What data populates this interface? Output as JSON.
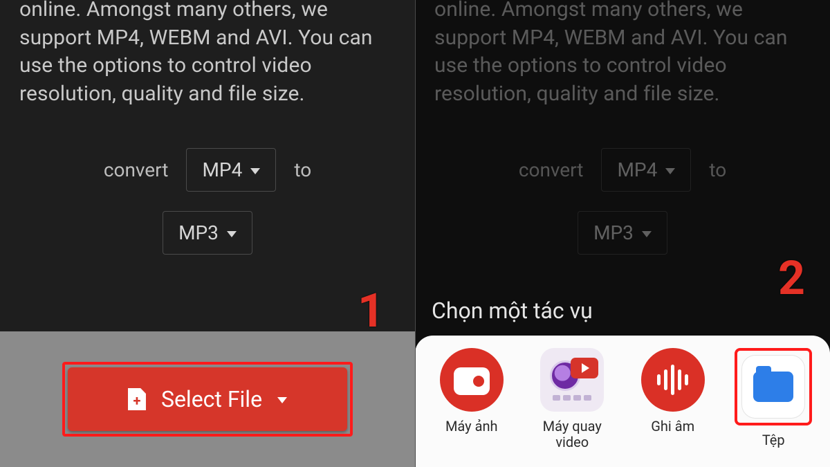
{
  "description": "online. Amongst many others, we support MP4, WEBM and AVI. You can use the options to control video resolution, quality and file size.",
  "convert": {
    "label_before": "convert",
    "from_format": "MP4",
    "label_after": "to",
    "to_format": "MP3"
  },
  "step1": {
    "badge": "1"
  },
  "step2": {
    "badge": "2"
  },
  "select_file_label": "Select File",
  "sheet": {
    "title": "Chọn một tác vụ",
    "apps": {
      "camera": "Máy ảnh",
      "video_rec": "Máy quay video",
      "voice_rec": "Ghi âm",
      "files": "Tệp"
    }
  }
}
